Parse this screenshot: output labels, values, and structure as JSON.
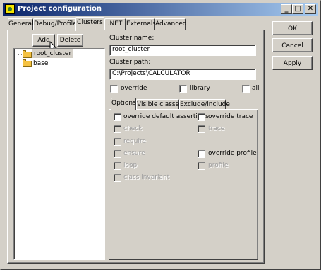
{
  "window": {
    "title": "Project configuration",
    "controls": {
      "minimize": "_",
      "maximize": "□",
      "close": "✕"
    }
  },
  "tabs": [
    {
      "label": "General",
      "active": false
    },
    {
      "label": "Debug/Profile",
      "active": false
    },
    {
      "label": "Clusters",
      "active": true
    },
    {
      "label": ".NET",
      "active": false
    },
    {
      "label": "Externals",
      "active": false
    },
    {
      "label": "Advanced",
      "active": false
    }
  ],
  "dialog_buttons": {
    "ok": "OK",
    "cancel": "Cancel",
    "apply": "Apply"
  },
  "clusters": {
    "add_label": "Add",
    "delete_label": "Delete",
    "tree": [
      {
        "name": "root_cluster",
        "selected": true
      },
      {
        "name": "base",
        "selected": false
      }
    ]
  },
  "cluster_form": {
    "name_label": "Cluster name:",
    "name_value": "root_cluster",
    "path_label": "Cluster path:",
    "path_value": "C:\\Projects\\CALCULATOR",
    "override_label": "override",
    "library_label": "library",
    "all_label": "all"
  },
  "subtabs": [
    {
      "label": "Options",
      "active": true
    },
    {
      "label": "Visible classes",
      "active": false
    },
    {
      "label": "Exclude/include",
      "active": false
    }
  ],
  "options": {
    "override_default_assertions": "override default assertions",
    "check": "check",
    "require": "require",
    "ensure": "ensure",
    "loop": "loop",
    "class_invariant": "class invariant",
    "override_trace": "override trace",
    "trace": "trace",
    "override_profile": "override profile",
    "profile": "profile"
  },
  "colors": {
    "title_start": "#0a246a",
    "title_end": "#a6caf0",
    "face": "#d4d0c8",
    "selection": "#d4d0c8"
  },
  "icons": [
    "app-icon",
    "folder-icon",
    "mouse-cursor-icon"
  ]
}
